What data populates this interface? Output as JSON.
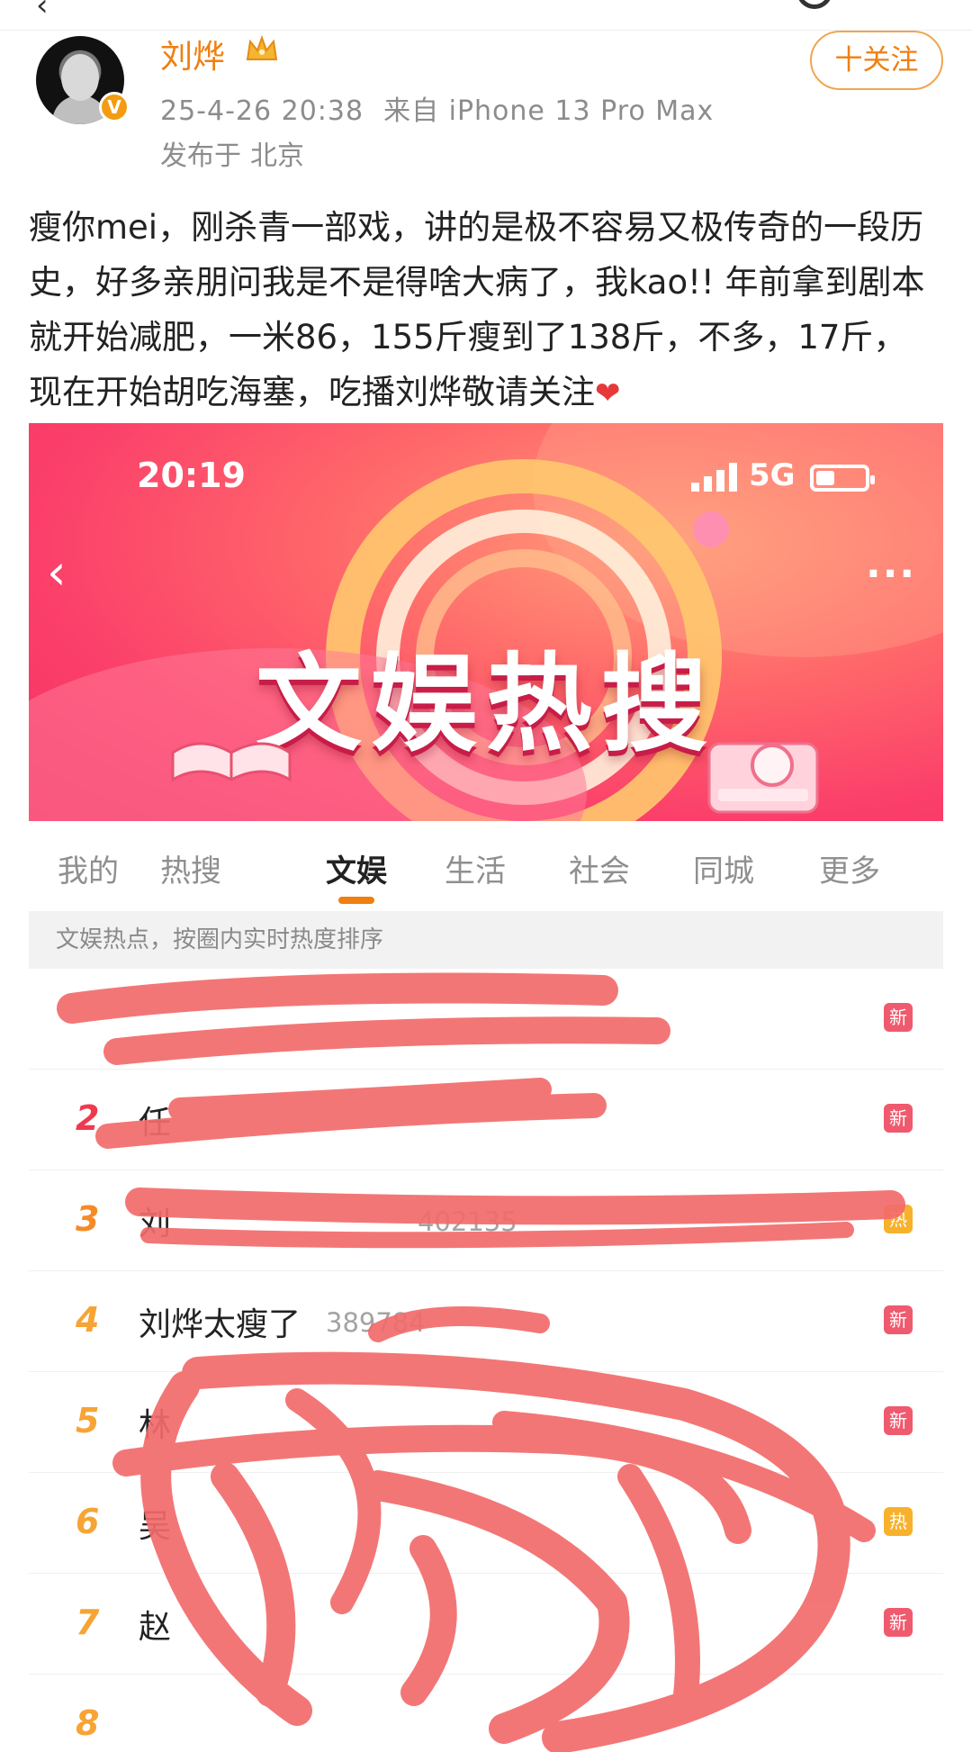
{
  "post": {
    "author": "刘烨",
    "date": "25-4-26 20:38",
    "source": "来自 iPhone 13 Pro Max",
    "location_label": "发布于",
    "location": "北京",
    "follow_label": "十关注",
    "text": "瘦你mei，刚杀青一部戏，讲的是极不容易又极传奇的一段历史，好多亲朋问我是不是得啥大病了，我kao!! 年前拿到剧本就开始减肥，一米86，155斤瘦到了138斤，不多，17斤，现在开始胡吃海塞，吃播刘烨敬请关注",
    "text_icon": "heart-icon"
  },
  "embedded": {
    "status_time": "20:19",
    "network": "5G",
    "banner_title": "文娱热搜",
    "tabs": [
      {
        "label": "我的"
      },
      {
        "label": "热搜"
      },
      {
        "label": "文娱",
        "active": true
      },
      {
        "label": "生活"
      },
      {
        "label": "社会"
      },
      {
        "label": "同城"
      },
      {
        "label": "更多"
      }
    ],
    "hint": "文娱热点，按圈内实时热度排序",
    "rows": [
      {
        "rank": "",
        "title": "",
        "count": "",
        "tag": "新"
      },
      {
        "rank": "2",
        "title": "任",
        "count": "",
        "tag": "新"
      },
      {
        "rank": "3",
        "title": "刘",
        "count": "402135",
        "tag": "热"
      },
      {
        "rank": "4",
        "title": "刘烨太瘦了",
        "count": "389784",
        "tag": "新"
      },
      {
        "rank": "5",
        "title": "林",
        "count": "",
        "tag": "新"
      },
      {
        "rank": "6",
        "title": "吴",
        "count": "",
        "tag": "热"
      },
      {
        "rank": "7",
        "title": "赵",
        "count": "",
        "tag": "新"
      },
      {
        "rank": "8",
        "title": "",
        "count": "",
        "tag": ""
      }
    ]
  },
  "colors": {
    "accent": "#f07f0f",
    "banner": "#f12f63",
    "scribble": "#f26b6b",
    "tag_new": "#ef5a6e",
    "tag_hot": "#f7b12b"
  }
}
